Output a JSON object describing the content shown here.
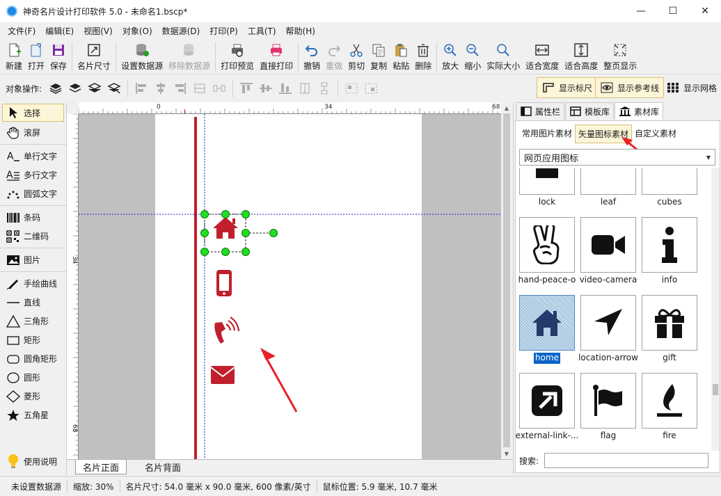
{
  "app": {
    "title": "神奇名片设计打印软件 5.0 - 未命名1.bscp*"
  },
  "window_controls": {
    "minimize": "—",
    "maximize": "☐",
    "close": "✕"
  },
  "menu": [
    "文件(F)",
    "编辑(E)",
    "视图(V)",
    "对象(O)",
    "数据源(D)",
    "打印(P)",
    "工具(T)",
    "帮助(H)"
  ],
  "toolbar": {
    "new": "新建",
    "open": "打开",
    "save": "保存",
    "card_size": "名片尺寸",
    "set_datasource": "设置数据源",
    "remove_datasource": "移除数据源",
    "print_preview": "打印预览",
    "direct_print": "直接打印",
    "undo": "撤销",
    "redo": "重做",
    "cut": "剪切",
    "copy": "复制",
    "paste": "粘贴",
    "delete": "删除",
    "zoom_in": "放大",
    "zoom_out": "缩小",
    "actual_size": "实际大小",
    "fit_width": "适合宽度",
    "fit_height": "适合高度",
    "fit_page": "整页显示"
  },
  "objbar": {
    "label": "对象操作:",
    "show_ruler": "显示标尺",
    "show_guides": "显示参考线",
    "show_grid": "显示网格"
  },
  "tools": {
    "select": "选择",
    "scroll": "滚屏",
    "single_text": "单行文字",
    "multi_text": "多行文字",
    "arc_text": "圆弧文字",
    "barcode": "条码",
    "qrcode": "二维码",
    "image": "图片",
    "freehand": "手绘曲线",
    "line": "直线",
    "triangle": "三角形",
    "rect": "矩形",
    "round_rect": "圆角矩形",
    "circle": "圆形",
    "diamond": "菱形",
    "star": "五角星",
    "help": "使用说明"
  },
  "rulers": {
    "h_labels": [
      "0",
      "34",
      "68"
    ],
    "v_labels": [
      "34",
      "68"
    ]
  },
  "page_tabs": {
    "front": "名片正面",
    "back": "名片背面"
  },
  "right_panel": {
    "tabs": {
      "properties": "属性栏",
      "templates": "模板库",
      "materials": "素材库"
    },
    "subtabs": {
      "common_images": "常用图片素材",
      "vector_icons": "矢量图标素材",
      "custom": "自定义素材"
    },
    "category": "网页应用图标",
    "icons": [
      "lock",
      "leaf",
      "cubes",
      "hand-peace-o",
      "video-camera",
      "info",
      "home",
      "location-arrow",
      "gift",
      "external-link-...",
      "flag",
      "fire"
    ],
    "search_label": "搜索:",
    "search_value": ""
  },
  "status": {
    "datasource": "未设置数据源",
    "zoom": "缩放: 30%",
    "card_size": "名片尺寸: 54.0 毫米 x 90.0 毫米, 600 像素/英寸",
    "mouse_pos": "鼠标位置: 5.9 毫米, 10.7 毫米"
  },
  "colors": {
    "accent_red": "#c01f2c",
    "selection_green": "#22dd22",
    "guide_blue": "#1a1ad0",
    "icon_dark": "#111111"
  }
}
